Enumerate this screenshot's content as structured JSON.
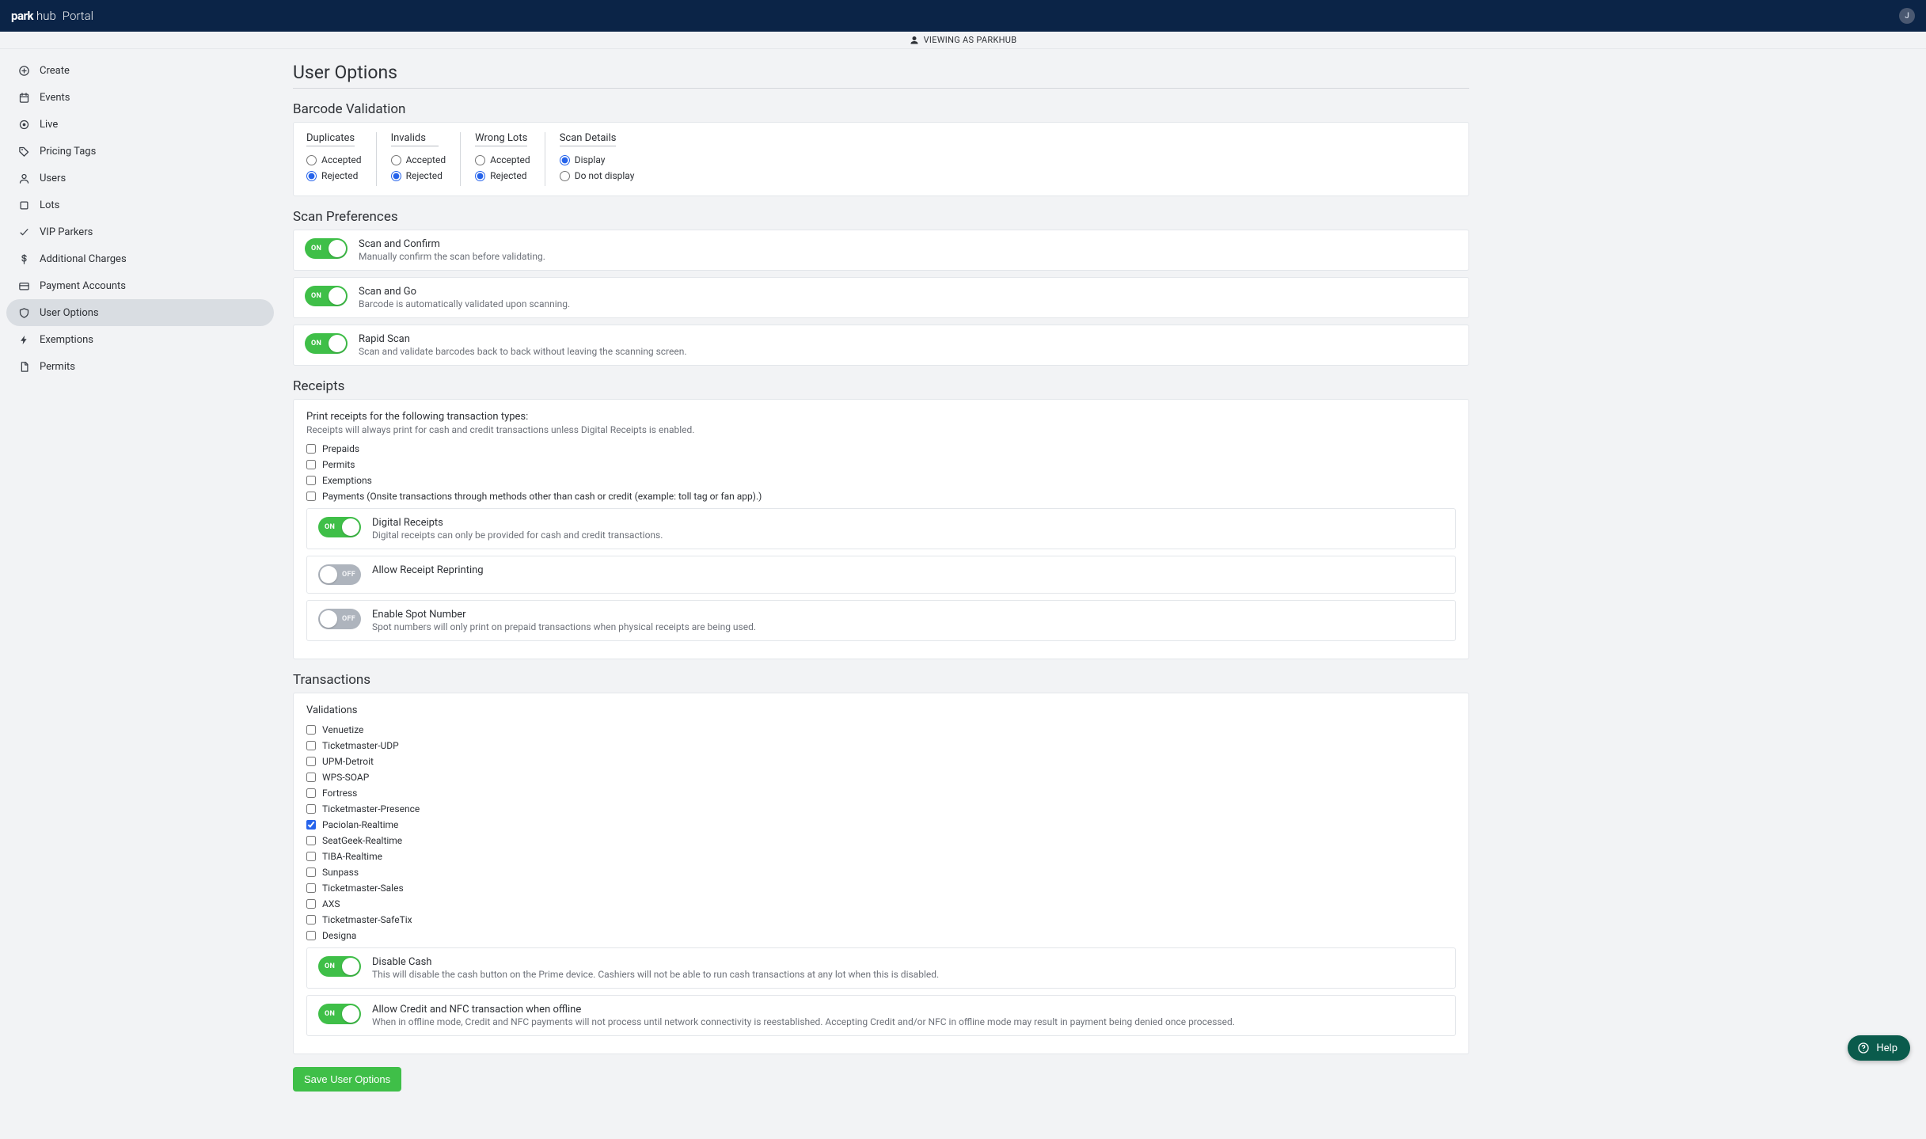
{
  "brand": {
    "park": "park",
    "hub": "hub",
    "portal": "Portal"
  },
  "avatar_initial": "J",
  "viewing_as": "VIEWING AS PARKHUB",
  "sidebar": {
    "items": [
      {
        "label": "Create",
        "icon": "plus"
      },
      {
        "label": "Events",
        "icon": "calendar"
      },
      {
        "label": "Live",
        "icon": "pulse"
      },
      {
        "label": "Pricing Tags",
        "icon": "tag"
      },
      {
        "label": "Users",
        "icon": "user"
      },
      {
        "label": "Lots",
        "icon": "square"
      },
      {
        "label": "VIP Parkers",
        "icon": "check"
      },
      {
        "label": "Additional Charges",
        "icon": "dollar"
      },
      {
        "label": "Payment Accounts",
        "icon": "card"
      },
      {
        "label": "User Options",
        "icon": "shield"
      },
      {
        "label": "Exemptions",
        "icon": "bolt"
      },
      {
        "label": "Permits",
        "icon": "doc"
      }
    ],
    "active_index": 9
  },
  "page": {
    "title": "User Options",
    "barcode_validation": {
      "heading": "Barcode Validation",
      "columns": [
        {
          "title": "Duplicates",
          "opt_a": "Accepted",
          "opt_b": "Rejected",
          "selected": "b"
        },
        {
          "title": "Invalids",
          "opt_a": "Accepted",
          "opt_b": "Rejected",
          "selected": "b"
        },
        {
          "title": "Wrong Lots",
          "opt_a": "Accepted",
          "opt_b": "Rejected",
          "selected": "b"
        },
        {
          "title": "Scan Details",
          "opt_a": "Display",
          "opt_b": "Do not display",
          "selected": "a"
        }
      ]
    },
    "scan_prefs": {
      "heading": "Scan Preferences",
      "items": [
        {
          "title": "Scan and Confirm",
          "desc": "Manually confirm the scan before validating.",
          "on": true
        },
        {
          "title": "Scan and Go",
          "desc": "Barcode is automatically validated upon scanning.",
          "on": true
        },
        {
          "title": "Rapid Scan",
          "desc": "Scan and validate barcodes back to back without leaving the scanning screen.",
          "on": true
        }
      ]
    },
    "receipts": {
      "heading": "Receipts",
      "instr_title": "Print receipts for the following transaction types:",
      "instr_sub": "Receipts will always print for cash and credit transactions unless Digital Receipts is enabled.",
      "types": [
        {
          "label": "Prepaids",
          "checked": false
        },
        {
          "label": "Permits",
          "checked": false
        },
        {
          "label": "Exemptions",
          "checked": false
        },
        {
          "label": "Payments (Onsite transactions through methods other than cash or credit (example: toll tag or fan app).)",
          "checked": false
        }
      ],
      "toggles": [
        {
          "title": "Digital Receipts",
          "desc": "Digital receipts can only be provided for cash and credit transactions.",
          "on": true
        },
        {
          "title": "Allow Receipt Reprinting",
          "desc": "",
          "on": false
        },
        {
          "title": "Enable Spot Number",
          "desc": "Spot numbers will only print on prepaid transactions when physical receipts are being used.",
          "on": false
        }
      ]
    },
    "transactions": {
      "heading": "Transactions",
      "subheading": "Validations",
      "providers": [
        {
          "label": "Venuetize",
          "checked": false
        },
        {
          "label": "Ticketmaster-UDP",
          "checked": false
        },
        {
          "label": "UPM-Detroit",
          "checked": false
        },
        {
          "label": "WPS-SOAP",
          "checked": false
        },
        {
          "label": "Fortress",
          "checked": false
        },
        {
          "label": "Ticketmaster-Presence",
          "checked": false
        },
        {
          "label": "Paciolan-Realtime",
          "checked": true
        },
        {
          "label": "SeatGeek-Realtime",
          "checked": false
        },
        {
          "label": "TIBA-Realtime",
          "checked": false
        },
        {
          "label": "Sunpass",
          "checked": false
        },
        {
          "label": "Ticketmaster-Sales",
          "checked": false
        },
        {
          "label": "AXS",
          "checked": false
        },
        {
          "label": "Ticketmaster-SafeTix",
          "checked": false
        },
        {
          "label": "Designa",
          "checked": false
        }
      ],
      "toggles": [
        {
          "title": "Disable Cash",
          "desc": "This will disable the cash button on the Prime device. Cashiers will not be able to run cash transactions at any lot when this is disabled.",
          "on": true
        },
        {
          "title": "Allow Credit and NFC transaction when offline",
          "desc": "When in offline mode, Credit and NFC payments will not process until network connectivity is reestablished. Accepting Credit and/or NFC in offline mode may result in payment being denied once processed.",
          "on": true
        }
      ]
    },
    "save_label": "Save User Options",
    "help_label": "Help"
  }
}
